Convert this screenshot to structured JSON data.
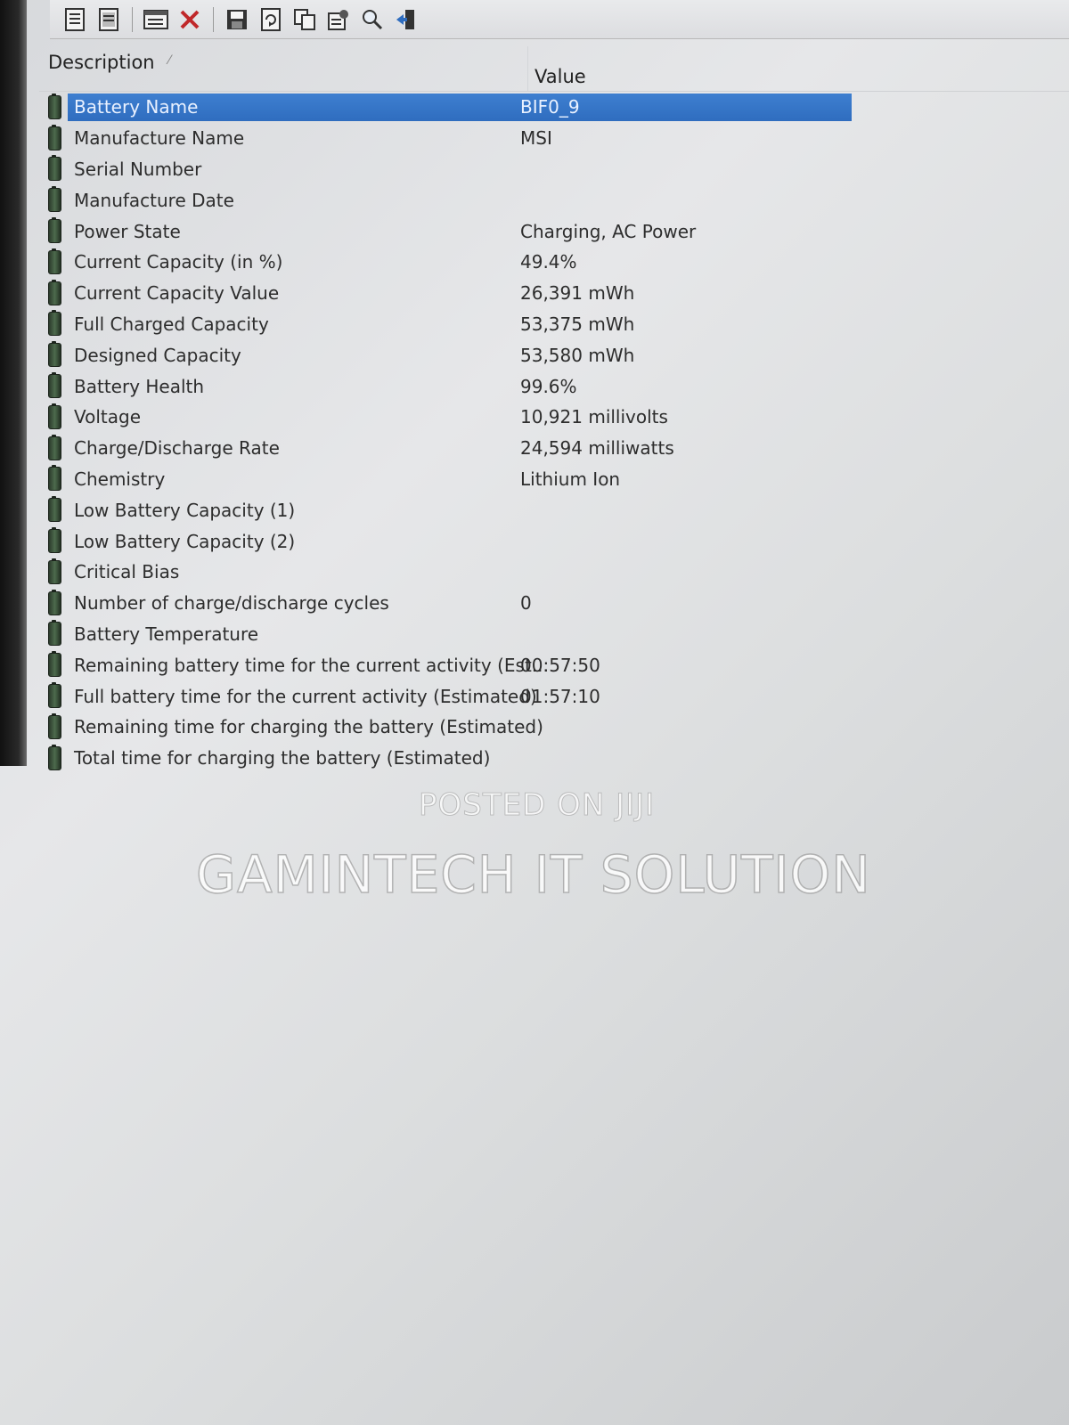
{
  "toolbar": {
    "buttons": [
      {
        "icon": "html-report-selected-icon"
      },
      {
        "icon": "html-report-all-icon"
      },
      {
        "icon": "properties-window-icon"
      },
      {
        "icon": "delete-x-icon"
      },
      {
        "icon": "save-icon"
      },
      {
        "icon": "refresh-icon"
      },
      {
        "icon": "copy-icon"
      },
      {
        "icon": "options-icon"
      },
      {
        "icon": "find-icon"
      },
      {
        "icon": "exit-icon"
      }
    ]
  },
  "columns": {
    "description": "Description",
    "value": "Value"
  },
  "rows": [
    {
      "label": "Battery Name",
      "value": "BIF0_9",
      "selected": true
    },
    {
      "label": "Manufacture Name",
      "value": "MSI"
    },
    {
      "label": "Serial Number",
      "value": ""
    },
    {
      "label": "Manufacture Date",
      "value": ""
    },
    {
      "label": "Power State",
      "value": "Charging, AC Power"
    },
    {
      "label": "Current Capacity (in %)",
      "value": "49.4%"
    },
    {
      "label": "Current Capacity Value",
      "value": "26,391 mWh"
    },
    {
      "label": "Full Charged Capacity",
      "value": "53,375 mWh"
    },
    {
      "label": "Designed Capacity",
      "value": "53,580 mWh"
    },
    {
      "label": "Battery Health",
      "value": "99.6%"
    },
    {
      "label": "Voltage",
      "value": "10,921 millivolts"
    },
    {
      "label": "Charge/Discharge Rate",
      "value": "24,594 milliwatts"
    },
    {
      "label": "Chemistry",
      "value": "Lithium Ion"
    },
    {
      "label": "Low Battery Capacity (1)",
      "value": ""
    },
    {
      "label": "Low Battery Capacity (2)",
      "value": ""
    },
    {
      "label": "Critical Bias",
      "value": ""
    },
    {
      "label": "Number of charge/discharge cycles",
      "value": "0"
    },
    {
      "label": "Battery Temperature",
      "value": ""
    },
    {
      "label": "Remaining battery time for the current activity (Est...",
      "value": "00:57:50"
    },
    {
      "label": "Full battery time for the current activity (Estimated)",
      "value": "01:57:10"
    },
    {
      "label": "Remaining time for charging the battery (Estimated)",
      "value": ""
    },
    {
      "label": "Total  time for charging the battery (Estimated)",
      "value": ""
    }
  ],
  "watermark": {
    "line1": "POSTED ON JIJI",
    "line2": "GAMINTECH IT SOLUTION"
  },
  "colors": {
    "selection": "#2f6dbf",
    "background": "#e2e3e5"
  }
}
